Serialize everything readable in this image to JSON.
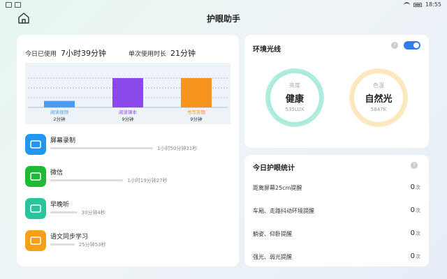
{
  "status": {
    "time": "18:55"
  },
  "header": {
    "title": "护眼助手"
  },
  "usage": {
    "today_label": "今日已使用",
    "today_value": "7小时39分钟",
    "single_label": "单次使用时长",
    "single_value": "21分钟"
  },
  "chart_data": {
    "type": "bar",
    "categories": [
      "阅读视频",
      "阅读课本",
      "书写答题"
    ],
    "values": [
      2,
      9,
      9
    ],
    "value_labels": [
      "2分钟",
      "9分钟",
      "9分钟"
    ],
    "ylim": [
      0,
      12
    ],
    "colors": [
      "#4a9cf2",
      "#8b49ea",
      "#f7941d"
    ],
    "grid": true
  },
  "apps": [
    {
      "name": "屏幕录制",
      "time": "1小时50分钟31秒",
      "fraction": 0.38,
      "icon": "screen-record-icon",
      "color": "#2196f3"
    },
    {
      "name": "微信",
      "time": "1小时19分钟27秒",
      "fraction": 0.27,
      "icon": "wechat-icon",
      "color": "#1fba33"
    },
    {
      "name": "早晚听",
      "time": "30分钟4秒",
      "fraction": 0.1,
      "icon": "listen-icon",
      "color": "#29c39c"
    },
    {
      "name": "语文同步学习",
      "time": "25分钟53秒",
      "fraction": 0.09,
      "icon": "pen-icon",
      "color": "#f6a01a"
    }
  ],
  "environment": {
    "title": "环境光线",
    "toggle_on": true,
    "brightness": {
      "label": "亮度",
      "value": "健康",
      "sub": "535LUX",
      "color": "#a5ead9"
    },
    "color_temp": {
      "label": "色温",
      "value": "自然光",
      "sub": "5847K",
      "color": "#fbe6b8"
    }
  },
  "stats": {
    "title": "今日护眼统计",
    "unit": "次",
    "rows": [
      {
        "label": "距离屏幕25cm提醒",
        "count": "0"
      },
      {
        "label": "车厢、走路抖动环境提醒",
        "count": "0"
      },
      {
        "label": "躺姿、仰卧提醒",
        "count": "0"
      },
      {
        "label": "强光、弱光提醒",
        "count": "0"
      }
    ]
  }
}
